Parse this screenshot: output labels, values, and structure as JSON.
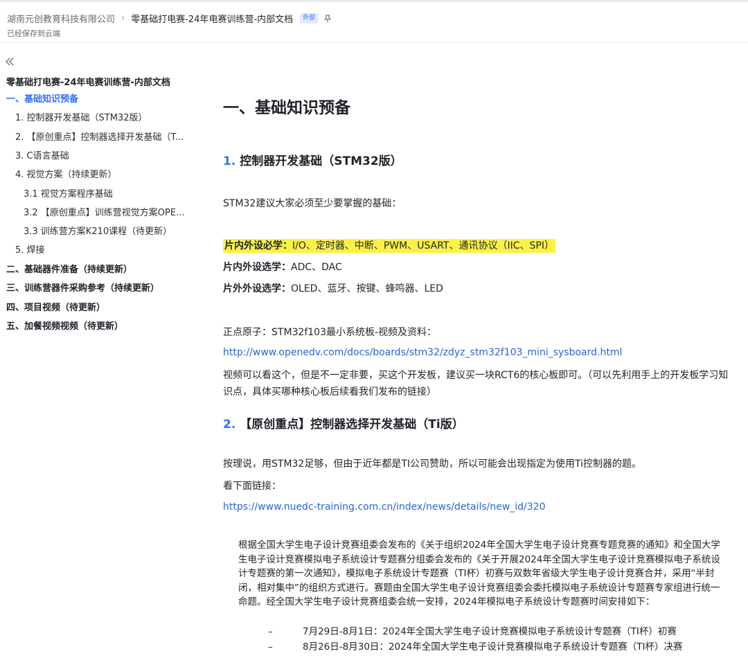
{
  "header": {
    "breadcrumb_root": "湖南元创教育科技有限公司",
    "breadcrumb_sep": "›",
    "breadcrumb_current": "零基础打电赛-24年电赛训练营-内部文档",
    "badge": "外部",
    "pin_icon": "pin-icon",
    "save_status": "已经保存到云端"
  },
  "sidebar": {
    "collapse_icon": "double-chevron-left-icon",
    "title": "零基础打电赛-24年电赛训练营-内部文档",
    "items": [
      {
        "label": "一、基础知识预备",
        "level": 1,
        "active": true
      },
      {
        "label": "1. 控制器开发基础（STM32版）",
        "level": 2
      },
      {
        "label": "2. 【原创重点】控制器选择开发基础（T...",
        "level": 2
      },
      {
        "label": "3. C语言基础",
        "level": 2
      },
      {
        "label": "4. 视觉方案（持续更新）",
        "level": 2
      },
      {
        "label": "3.1 视觉方案程序基础",
        "level": 3
      },
      {
        "label": "3.2 【原创重点】训练营视觉方案OPE...",
        "level": 3
      },
      {
        "label": "3.3 训练营方案K210课程（待更新）",
        "level": 3
      },
      {
        "label": "5. 焊接",
        "level": 2
      },
      {
        "label": "二、基础器件准备（持续更新）",
        "level": 1
      },
      {
        "label": "三、训练营器件采购参考（持续更新）",
        "level": 1
      },
      {
        "label": "四、项目视频（待更新）",
        "level": 1
      },
      {
        "label": "五、加餐视频视频（待更新）",
        "level": 1
      }
    ]
  },
  "content": {
    "h1": "一、基础知识预备",
    "section1": {
      "num": "1.",
      "title": "控制器开发基础（STM32版）",
      "intro": "STM32建议大家必须至少要掌握的基础：",
      "must_label": "片内外设必学：",
      "must_text": "I/O、定时器、中断、PWM、USART、通讯协议（IIC、SPI）",
      "optional_in_label": "片内外设选学：",
      "optional_in_text": "ADC、DAC",
      "optional_out_label": "片外外设选学：",
      "optional_out_text": "OLED、蓝牙、按键、蜂鸣器、LED",
      "atom_line": "正点原子：STM32f103最小系统板-视频及资料：",
      "atom_link": "http://www.openedv.com/docs/boards/stm32/zdyz_stm32f103_mini_sysboard.html",
      "advice": "视频可以看这个，但是不一定非要，买这个开发板，建议买一块RCT6的核心板即可。（可以先利用手上的开发板学习知识点，具体买哪种核心板后续看我们发布的链接）"
    },
    "section2": {
      "num": "2.",
      "title": "【原创重点】控制器选择开发基础（Ti版）",
      "p1": "按理说，用STM32足够，但由于近年都是TI公司赞助，所以可能会出现指定为使用Ti控制器的题。",
      "p2": "看下面链接：",
      "link": "https://www.nuedc-training.com.cn/index/news/details/new_id/320",
      "quote": "根据全国大学生电子设计竞赛组委会发布的《关于组织2024年全国大学生电子设计竞赛专题竞赛的通知》和全国大学生电子设计竞赛模拟电子系统设计专题赛分组委会发布的《关于开展2024年全国大学生电子设计竞赛模拟电子系统设计专题赛的第一次通知》，模拟电子系统设计专题赛（TI杯）初赛与双数年省级大学生电子设计竞赛合并，采用“半封闭，相对集中”的组织方式进行。赛题由全国大学生电子设计竞赛组委会委托模拟电子系统设计专题赛专家组进行统一命题。经全国大学生电子设计竞赛组委会统一安排，2024年模拟电子系统设计专题赛时间安排如下：",
      "bullets": [
        {
          "dash": "–",
          "text": "7月29日-8月1日：2024年全国大学生电子设计竞赛模拟电子系统设计专题赛（TI杯）初赛"
        },
        {
          "dash": "–",
          "text": "8月26日-8月30日：2024年全国大学生电子设计竞赛模拟电子系统设计专题赛（TI杯）决赛"
        }
      ]
    }
  }
}
